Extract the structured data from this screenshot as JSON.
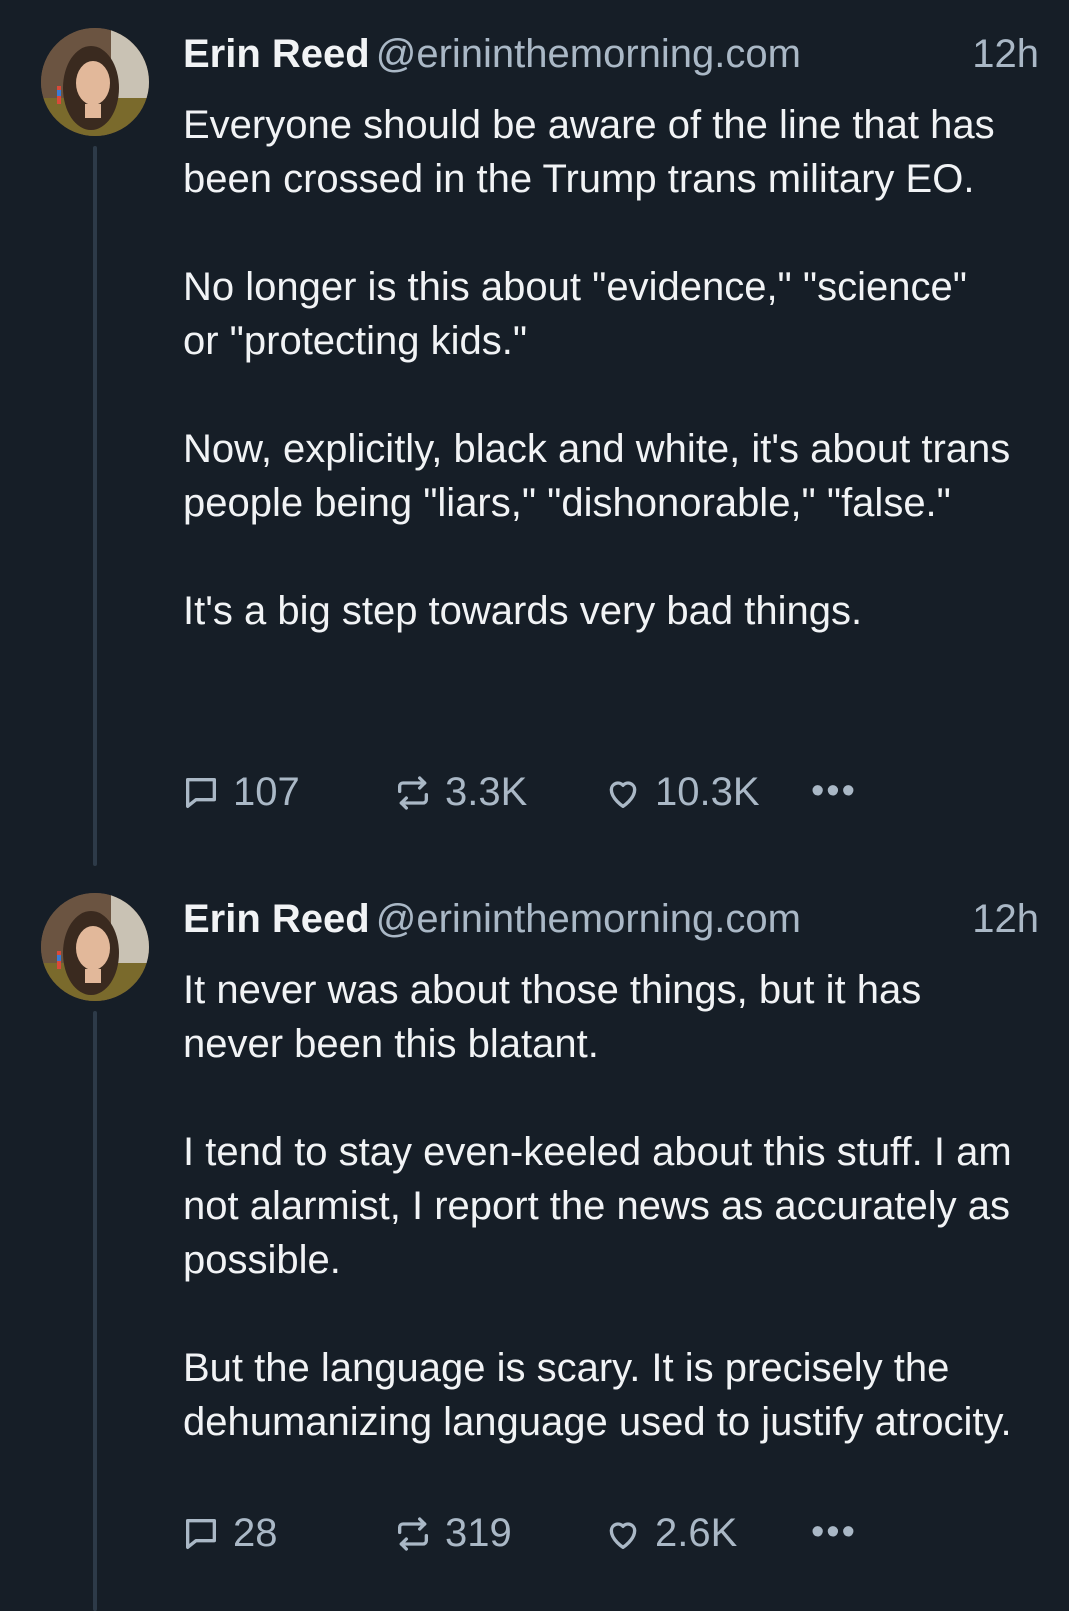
{
  "posts": [
    {
      "author_name": "Erin Reed",
      "handle": "@erininthemorning.com",
      "time": "12h",
      "paragraphs": [
        "Everyone should be aware of the line that has been crossed in the Trump trans military EO.",
        "No longer is this about \"evidence,\" \"science\" or \"protecting kids.\"",
        "Now, explicitly, black and white, it's about trans people being \"liars,\" \"dishonorable,\" \"false.\"",
        "It's a big step towards very bad things."
      ],
      "replies": "107",
      "reposts": "3.3K",
      "likes": "10.3K"
    },
    {
      "author_name": "Erin Reed",
      "handle": "@erininthemorning.com",
      "time": "12h",
      "paragraphs": [
        "It never was about those things, but it has never been this blatant.",
        "I tend to stay even-keeled about this stuff. I am not alarmist, I report the news as accurately as possible.",
        "But the language is scary. It is precisely the dehumanizing language used to justify atrocity."
      ],
      "replies": "28",
      "reposts": "319",
      "likes": "2.6K"
    }
  ],
  "icons": {
    "reply": "speech-bubble-icon",
    "repost": "repost-arrows-icon",
    "like": "heart-icon",
    "more": "more-dots-icon"
  },
  "more_label": "•••",
  "colors": {
    "background": "#161e27",
    "text": "#f1f3f5",
    "muted": "#aab8c6",
    "thread_line": "#2d3a48"
  }
}
